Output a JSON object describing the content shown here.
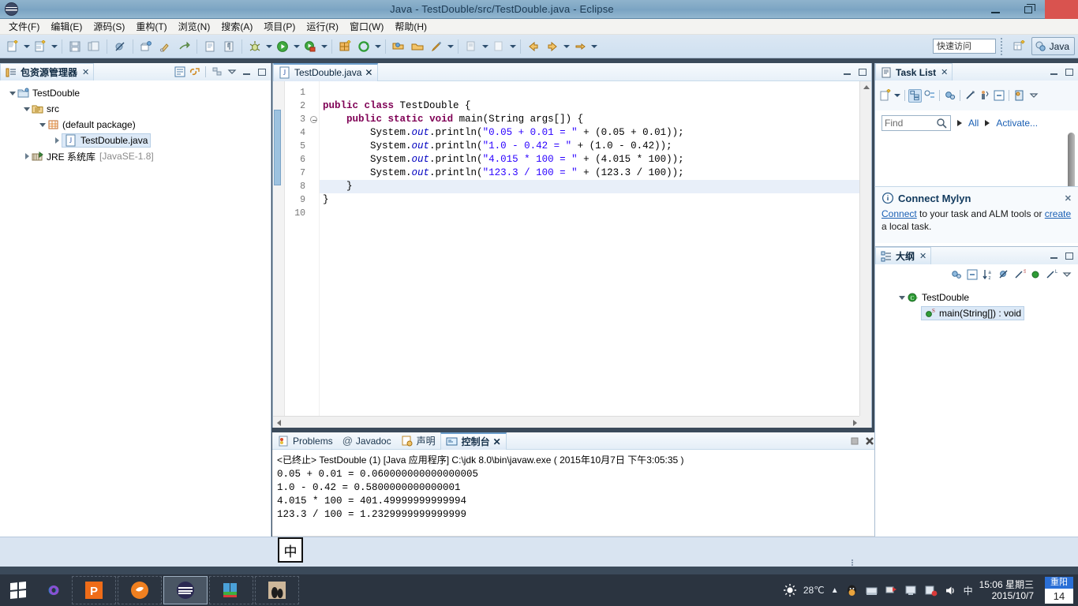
{
  "window": {
    "title": "Java - TestDouble/src/TestDouble.java - Eclipse",
    "minimize_label": "Minimize",
    "maximize_label": "Maximize",
    "close_label": "✕"
  },
  "menubar": {
    "items": [
      {
        "label": "文件(F)"
      },
      {
        "label": "编辑(E)"
      },
      {
        "label": "源码(S)"
      },
      {
        "label": "重构(T)"
      },
      {
        "label": "浏览(N)"
      },
      {
        "label": "搜索(A)"
      },
      {
        "label": "项目(P)"
      },
      {
        "label": "运行(R)"
      },
      {
        "label": "窗口(W)"
      },
      {
        "label": "帮助(H)"
      }
    ]
  },
  "toolbar": {
    "quick_access_placeholder": "快速访问",
    "quick_access_value": "",
    "perspective_label": "Java",
    "icons": [
      "new-wizard-icon",
      "new-wizard-dropdown-icon",
      "new-java-class-icon",
      "new-java-class-dropdown-icon",
      "save-icon",
      "save-all-icon",
      "skip-breakpoints-icon",
      "new-package-icon",
      "build-icon",
      "build-all-icon",
      "open-type-icon",
      "paragraph-marks-icon",
      "debug-icon",
      "debug-dropdown-icon",
      "run-icon",
      "run-dropdown-icon",
      "run-coverage-icon",
      "run-coverage-dropdown-icon",
      "external-tools-icon",
      "refresh-icon",
      "refresh-dropdown-icon",
      "open-type-search-icon",
      "open-task-icon",
      "last-edit-location-icon",
      "last-edit-dropdown-icon",
      "next-annotation-icon",
      "next-annotation-dropdown-icon",
      "previous-annotation-icon",
      "previous-annotation-dropdown-icon",
      "back-icon",
      "back-dropdown-icon",
      "forward-icon",
      "forward-dropdown-icon"
    ]
  },
  "package_explorer": {
    "tab_label": "包资源管理器",
    "tab_close": "✕",
    "toolbar_icons": [
      "collapse-all-icon",
      "link-with-editor-icon",
      "view-menu-icon",
      "minimize-icon",
      "maximize-icon"
    ],
    "tree": [
      {
        "label": "TestDouble",
        "icon": "java-project-icon",
        "indent": 0,
        "expanded": true,
        "selected": false,
        "sub": ""
      },
      {
        "label": "src",
        "icon": "source-folder-icon",
        "indent": 1,
        "expanded": true,
        "selected": false,
        "sub": ""
      },
      {
        "label": "(default package)",
        "icon": "package-icon",
        "indent": 2,
        "expanded": true,
        "selected": false,
        "sub": ""
      },
      {
        "label": "TestDouble.java",
        "icon": "java-file-icon",
        "indent": 3,
        "expanded": false,
        "selected": true,
        "sub": ""
      },
      {
        "label": "JRE 系统库",
        "icon": "jre-library-icon",
        "indent": 1,
        "expanded": false,
        "selected": false,
        "sub": "[JavaSE-1.8]"
      }
    ]
  },
  "editor": {
    "tab_label": "TestDouble.java",
    "tab_close": "✕",
    "tab_icon": "java-file-icon",
    "minimize_icon": "minimize-icon",
    "maximize_icon": "maximize-icon",
    "line_numbers": [
      "1",
      "2",
      "3",
      "4",
      "5",
      "6",
      "7",
      "8",
      "9",
      "10"
    ],
    "lines": [
      {
        "n": 1,
        "html": "",
        "highlight": false
      },
      {
        "n": 2,
        "html": "<span class=\"kw\">public</span> <span class=\"kw\">class</span> TestDouble {",
        "highlight": false
      },
      {
        "n": 3,
        "html": "    <span class=\"kw\">public</span> <span class=\"kw\">static</span> <span class=\"kw\">void</span> main(String args[]) {",
        "highlight": false
      },
      {
        "n": 4,
        "html": "        System.<span class=\"fld\">out</span>.println(<span class=\"str\">\"0.05 + 0.01 = \"</span> + (0.05 + 0.01));",
        "highlight": false
      },
      {
        "n": 5,
        "html": "        System.<span class=\"fld\">out</span>.println(<span class=\"str\">\"1.0 - 0.42 = \"</span> + (1.0 - 0.42));",
        "highlight": false
      },
      {
        "n": 6,
        "html": "        System.<span class=\"fld\">out</span>.println(<span class=\"str\">\"4.015 * 100 = \"</span> + (4.015 * 100));",
        "highlight": false
      },
      {
        "n": 7,
        "html": "        System.<span class=\"fld\">out</span>.println(<span class=\"str\">\"123.3 / 100 = \"</span> + (123.3 / 100));",
        "highlight": false
      },
      {
        "n": 8,
        "html": "    }",
        "highlight": true
      },
      {
        "n": 9,
        "html": "}",
        "highlight": false
      },
      {
        "n": 10,
        "html": "",
        "highlight": false
      }
    ]
  },
  "console": {
    "tabs": [
      {
        "label": "Problems",
        "icon": "problems-icon",
        "active": false,
        "close": ""
      },
      {
        "label": "Javadoc",
        "icon": "javadoc-icon",
        "active": false,
        "close": ""
      },
      {
        "label": "声明",
        "icon": "declaration-icon",
        "active": false,
        "close": ""
      },
      {
        "label": "控制台",
        "icon": "console-icon",
        "active": true,
        "close": "✕"
      }
    ],
    "header": "<已终止> TestDouble (1) [Java 应用程序] C:\\jdk 8.0\\bin\\javaw.exe ( 2015年10月7日 下午3:05:35 )",
    "output": [
      "0.05 + 0.01 = 0.060000000000000005",
      "1.0 - 0.42 = 0.5800000000000001",
      "4.015 * 100 = 401.49999999999994",
      "123.3 / 100 = 1.2329999999999999"
    ],
    "toolbar_icons": [
      "terminate-icon",
      "remove-launch-icon",
      "remove-all-launches-icon",
      "clear-console-icon",
      "scroll-lock-icon",
      "word-wrap-icon",
      "show-console-on-output-icon",
      "pin-console-icon",
      "display-selected-console-icon",
      "display-selected-dropdown-icon",
      "open-console-icon",
      "open-console-dropdown-icon",
      "minimize-icon",
      "maximize-icon"
    ]
  },
  "task_list": {
    "tab_label": "Task List",
    "tab_close": "✕",
    "find_placeholder": "Find",
    "find_value": "",
    "filter_all": "All",
    "activate_label": "Activate...",
    "toolbar_icons": [
      "new-task-icon",
      "new-task-dropdown-icon",
      "categorized-presentation-icon",
      "scheduled-presentation-icon",
      "synchronize-changed-icon",
      "focus-on-workweek-icon",
      "show-all-tasks-icon",
      "collapse-all-icon",
      "task-repositories-icon",
      "view-menu-icon"
    ],
    "minimize_icon": "minimize-icon",
    "maximize_icon": "maximize-icon"
  },
  "mylyn": {
    "title": "Connect Mylyn",
    "icon": "info-icon",
    "close": "✕",
    "text_parts": [
      "Connect",
      " to your task and ALM tools or ",
      "create",
      " a local task."
    ],
    "link1": "Connect",
    "link2": "create",
    "mid": " to your task and ALM tools or ",
    "end": " a local task."
  },
  "outline": {
    "tab_label": "大纲",
    "tab_close": "✕",
    "toolbar_icons": [
      "focus-on-active-task-icon",
      "collapse-all-icon",
      "sort-icon",
      "hide-fields-icon",
      "hide-static-icon",
      "hide-non-public-icon",
      "hide-local-types-icon",
      "view-menu-icon"
    ],
    "minimize_icon": "minimize-icon",
    "maximize_icon": "maximize-icon",
    "tree": [
      {
        "label": "TestDouble",
        "icon": "class-icon",
        "indent": 0,
        "expanded": true,
        "selected": false
      },
      {
        "label": "main(String[]) : void",
        "icon": "public-method-icon",
        "indent": 1,
        "expanded": false,
        "selected": true,
        "modifier": "S"
      }
    ]
  },
  "ime": {
    "label": "中"
  },
  "taskbar": {
    "start_label": "Start",
    "apps": [
      {
        "name": "wps-presentation",
        "active": false
      },
      {
        "name": "firefox-browser",
        "active": false
      },
      {
        "name": "eclipse-ide",
        "active": true
      },
      {
        "name": "winrar",
        "active": false
      },
      {
        "name": "penguin-photo",
        "active": false
      }
    ],
    "tray": {
      "weather_icon": "sun-icon",
      "temperature": "28℃",
      "overflow_icon": "show-hidden-icons-icon",
      "icons": [
        "qq-icon",
        "network-icon",
        "flag-icon",
        "monitor-icon",
        "antivirus-icon",
        "volume-icon"
      ],
      "ime_label": "中"
    },
    "clock": {
      "time": "15:06 星期三",
      "date": "2015/10/7"
    },
    "calendar": {
      "festival": "重阳",
      "day": "14"
    }
  }
}
